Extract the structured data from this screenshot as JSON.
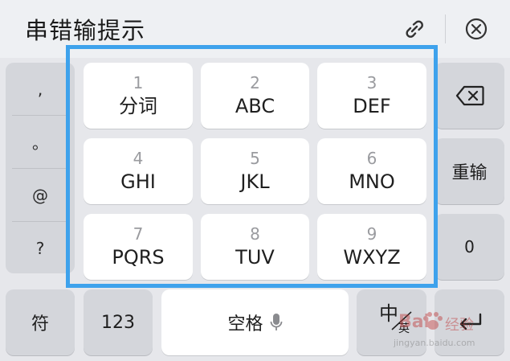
{
  "header": {
    "title": "串错输提示"
  },
  "symbols": [
    ",",
    "。",
    "@",
    "?"
  ],
  "keypad": [
    {
      "number": "1",
      "letters": "分词"
    },
    {
      "number": "2",
      "letters": "ABC"
    },
    {
      "number": "3",
      "letters": "DEF"
    },
    {
      "number": "4",
      "letters": "GHI"
    },
    {
      "number": "5",
      "letters": "JKL"
    },
    {
      "number": "6",
      "letters": "MNO"
    },
    {
      "number": "7",
      "letters": "PQRS"
    },
    {
      "number": "8",
      "letters": "TUV"
    },
    {
      "number": "9",
      "letters": "WXYZ"
    }
  ],
  "right_keys": {
    "reenter": "重输",
    "zero": "0"
  },
  "bottom_row": {
    "symbols": "符",
    "numbers": "123",
    "space": "空格",
    "lang_main": "中",
    "lang_sub": "英"
  },
  "watermark": {
    "brand": "Bai",
    "brand2": "经验",
    "url": "jingyan.baidu.com"
  },
  "colors": {
    "highlight": "#3ea2ec",
    "key_light": "#ffffff",
    "key_dark": "#d4d6db",
    "background": "#e6e7eb"
  }
}
